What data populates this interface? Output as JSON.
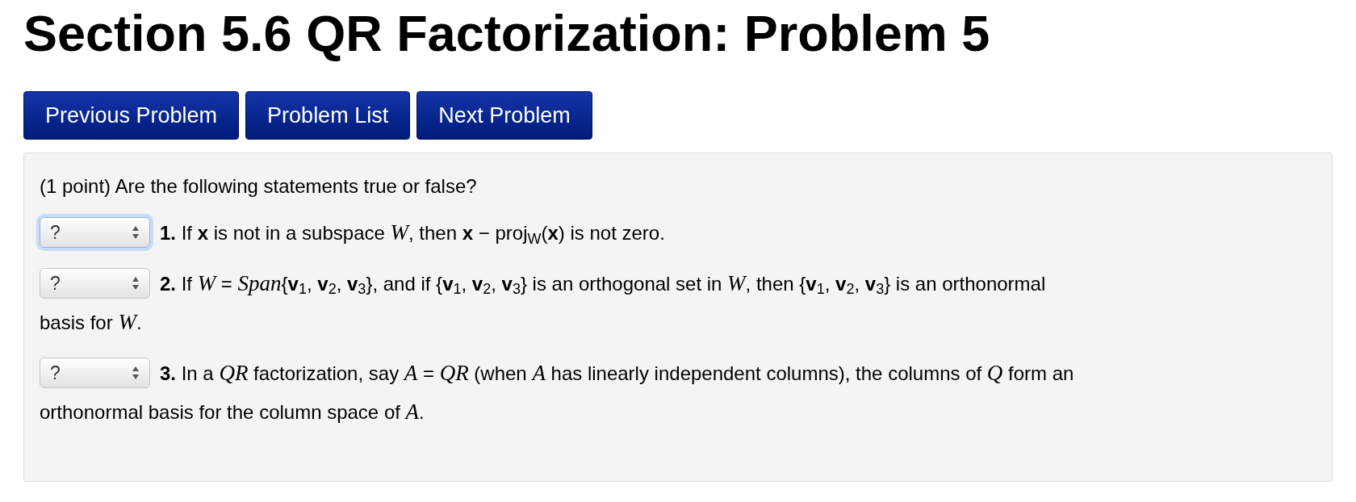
{
  "title": "Section 5.6 QR Factorization: Problem 5",
  "nav_buttons": [
    "Previous Problem",
    "Problem List",
    "Next Problem"
  ],
  "problem": {
    "intro": "(1 point) Are the following statements true or false?",
    "statements": [
      {
        "answer": "?",
        "focused": true,
        "lines": [
          "**1.** If **x** is not in a subspace *W*, then **x** − proj$_{W}$(**x**) is not zero."
        ]
      },
      {
        "answer": "?",
        "focused": false,
        "lines": [
          "**2.** If *W* = *Span*{**v**$_{1}$, **v**$_{2}$, **v**$_{3}$}, and if {**v**$_{1}$, **v**$_{2}$, **v**$_{3}$} is an orthogonal set in *W*, then {**v**$_{1}$, **v**$_{2}$, **v**$_{3}$} is an orthonormal",
          "basis for *W*."
        ]
      },
      {
        "answer": "?",
        "focused": false,
        "lines": [
          "**3.** In a *QR* factorization, say *A* = *QR* (when *A* has linearly independent columns), the columns of *Q* form an",
          "orthonormal basis for the column space of *A*."
        ]
      }
    ]
  }
}
